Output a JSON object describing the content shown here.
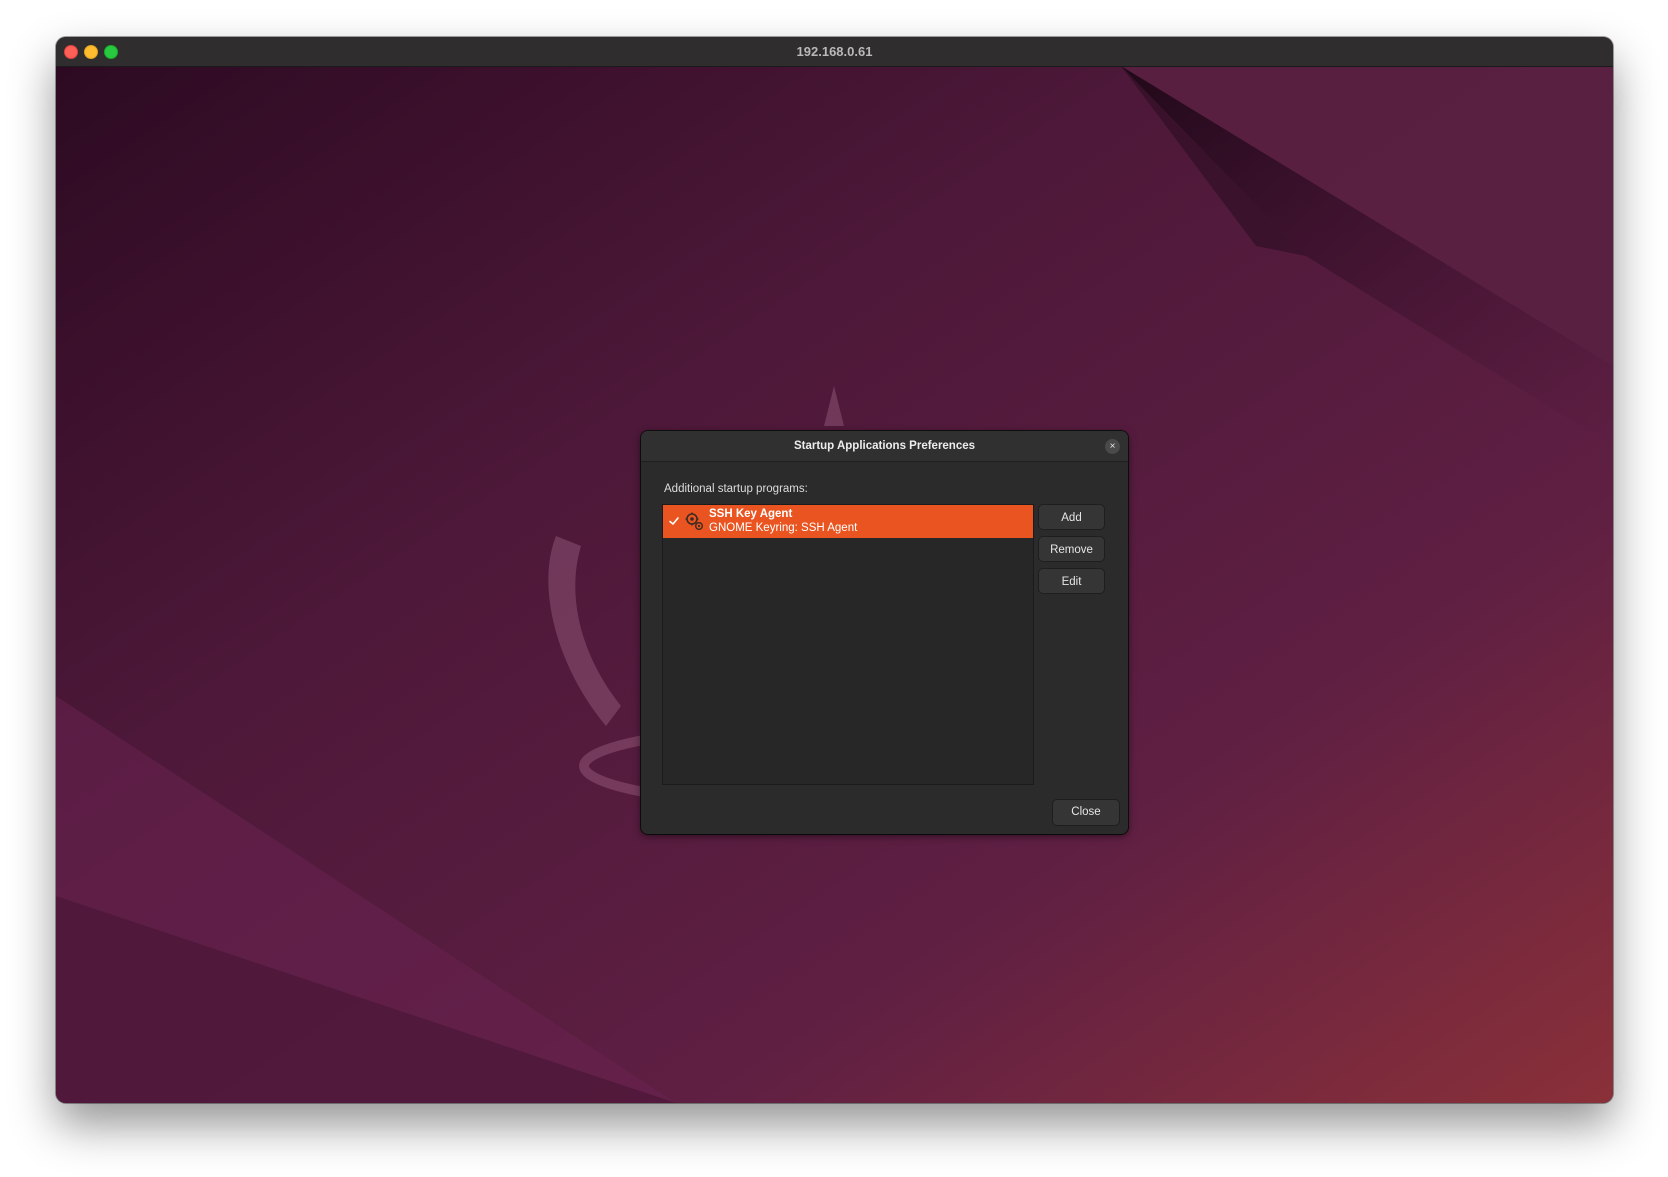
{
  "window": {
    "title": "192.168.0.61"
  },
  "dialog": {
    "title": "Startup Applications Preferences",
    "list_label": "Additional startup programs:",
    "programs": [
      {
        "name": "SSH Key Agent",
        "description": "GNOME Keyring: SSH Agent",
        "enabled": true,
        "selected": true,
        "icon": "gears-icon"
      }
    ],
    "buttons": {
      "add": "Add",
      "remove": "Remove",
      "edit": "Edit",
      "close": "Close"
    },
    "close_icon": "×"
  },
  "colors": {
    "accent": "#e95420",
    "desktop_dark": "#2d0a22",
    "desktop_mid": "#5c1c42",
    "desktop_light": "#7a2a4a",
    "dialog_bg": "#2b2b2b"
  }
}
